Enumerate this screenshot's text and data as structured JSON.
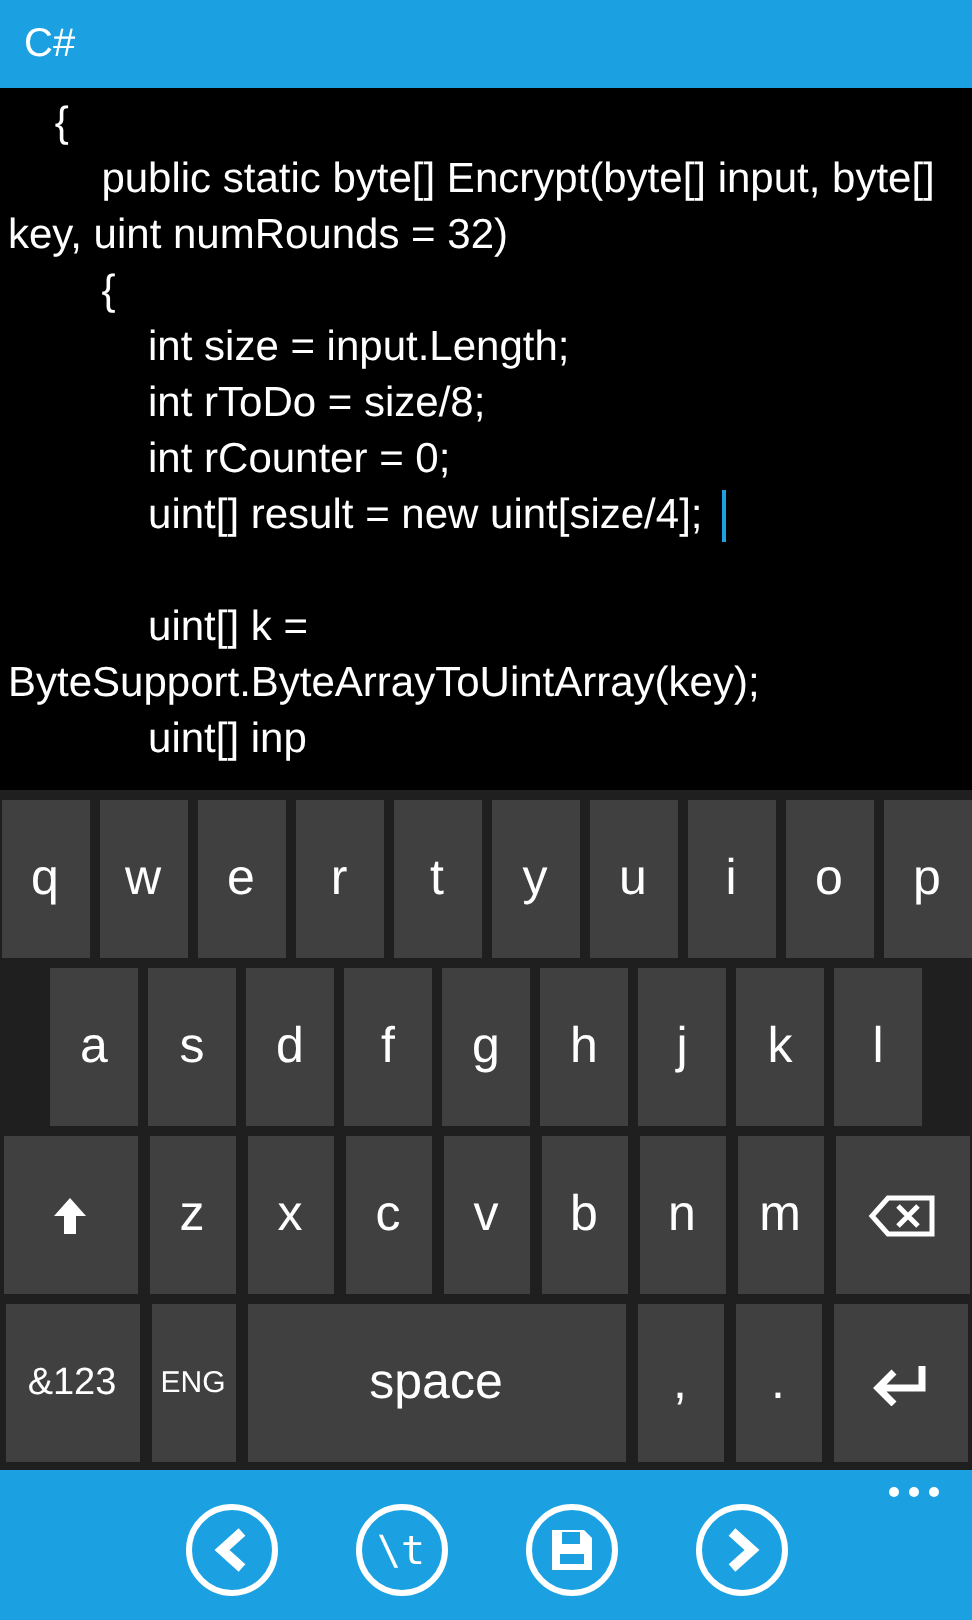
{
  "header": {
    "title": "C#"
  },
  "code_lines": [
    {
      "kind": "code",
      "text": "    {",
      "cursor": false
    },
    {
      "kind": "code",
      "text": "        public static byte[] Encrypt(byte[] input, byte[] key, uint numRounds = 32)",
      "cursor": false
    },
    {
      "kind": "code",
      "text": "        {",
      "cursor": false
    },
    {
      "kind": "code",
      "text": "            int size = input.Length;",
      "cursor": false
    },
    {
      "kind": "code",
      "text": "            int rToDo = size/8;",
      "cursor": false
    },
    {
      "kind": "code",
      "text": "            int rCounter = 0;",
      "cursor": false
    },
    {
      "kind": "code",
      "text": "            uint[] result = new uint[size/4];",
      "cursor": true
    },
    {
      "kind": "blank"
    },
    {
      "kind": "code",
      "text": "            uint[] k = ByteSupport.ByteArrayToUintArray(key);",
      "cursor": false
    },
    {
      "kind": "code",
      "text": "            uint[] inp",
      "cursor": false
    }
  ],
  "keyboard": {
    "rows": [
      {
        "keys": [
          {
            "kind": "letter",
            "label": "q"
          },
          {
            "kind": "letter",
            "label": "w"
          },
          {
            "kind": "letter",
            "label": "e"
          },
          {
            "kind": "letter",
            "label": "r"
          },
          {
            "kind": "letter",
            "label": "t"
          },
          {
            "kind": "letter",
            "label": "y"
          },
          {
            "kind": "letter",
            "label": "u"
          },
          {
            "kind": "letter",
            "label": "i"
          },
          {
            "kind": "letter",
            "label": "o"
          },
          {
            "kind": "letter",
            "label": "p"
          }
        ]
      },
      {
        "keys": [
          {
            "kind": "letter",
            "label": "a"
          },
          {
            "kind": "letter",
            "label": "s"
          },
          {
            "kind": "letter",
            "label": "d"
          },
          {
            "kind": "letter",
            "label": "f"
          },
          {
            "kind": "letter",
            "label": "g"
          },
          {
            "kind": "letter",
            "label": "h"
          },
          {
            "kind": "letter",
            "label": "j"
          },
          {
            "kind": "letter",
            "label": "k"
          },
          {
            "kind": "letter",
            "label": "l"
          }
        ]
      },
      {
        "keys": [
          {
            "kind": "shift"
          },
          {
            "kind": "letter",
            "label": "z"
          },
          {
            "kind": "letter",
            "label": "x"
          },
          {
            "kind": "letter",
            "label": "c"
          },
          {
            "kind": "letter",
            "label": "v"
          },
          {
            "kind": "letter",
            "label": "b"
          },
          {
            "kind": "letter",
            "label": "n"
          },
          {
            "kind": "letter",
            "label": "m"
          },
          {
            "kind": "backspace"
          }
        ]
      },
      {
        "keys": [
          {
            "kind": "symbols",
            "label": "&123"
          },
          {
            "kind": "language",
            "label": "ENG"
          },
          {
            "kind": "space",
            "label": "space"
          },
          {
            "kind": "letter",
            "label": ","
          },
          {
            "kind": "letter",
            "label": "."
          },
          {
            "kind": "enter"
          }
        ]
      }
    ]
  },
  "app_bar": {
    "buttons": [
      {
        "kind": "back"
      },
      {
        "kind": "text",
        "label": "\\t"
      },
      {
        "kind": "save"
      },
      {
        "kind": "forward"
      }
    ]
  }
}
